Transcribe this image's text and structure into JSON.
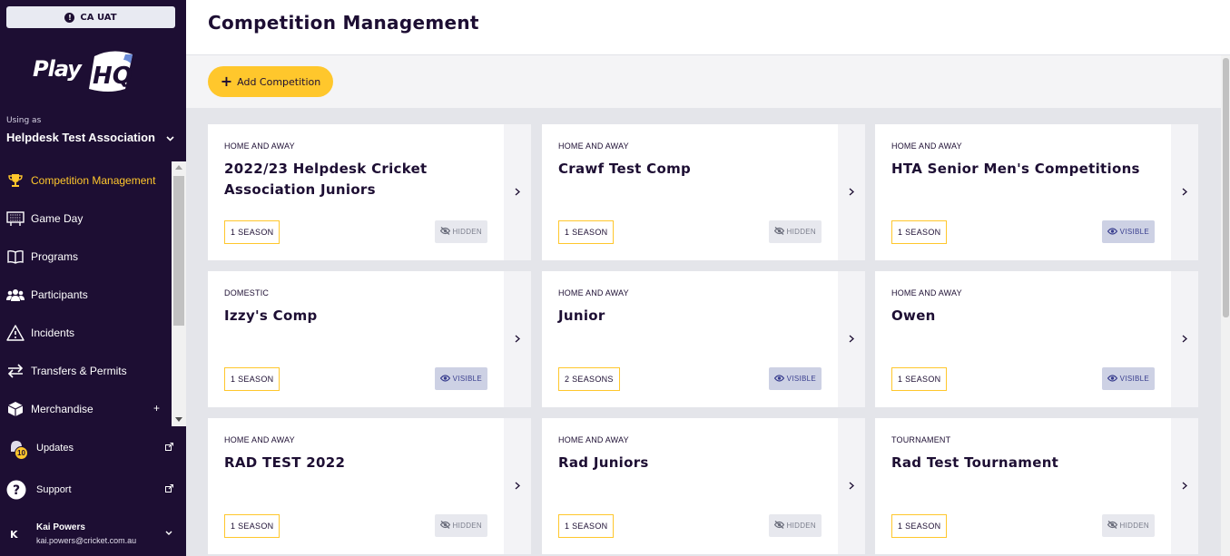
{
  "environment": {
    "label": "CA UAT",
    "icon": "info-icon"
  },
  "brand": {
    "logo_text": "Play",
    "logo_mark": "HQ"
  },
  "org": {
    "using_as": "Using as",
    "name": "Helpdesk Test Association"
  },
  "nav": [
    {
      "label": "Competition Management",
      "icon": "trophy-icon",
      "active": true
    },
    {
      "label": "Game Day",
      "icon": "scoreboard-icon"
    },
    {
      "label": "Programs",
      "icon": "book-icon"
    },
    {
      "label": "Participants",
      "icon": "people-icon"
    },
    {
      "label": "Incidents",
      "icon": "warning-icon"
    },
    {
      "label": "Transfers & Permits",
      "icon": "transfer-icon"
    },
    {
      "label": "Merchandise",
      "icon": "box-icon",
      "expandable": "+"
    }
  ],
  "footer": {
    "updates": {
      "label": "Updates",
      "badge": "10"
    },
    "support": {
      "label": "Support"
    }
  },
  "user": {
    "initial": "K",
    "name": "Kai Powers",
    "email": "kai.powers@cricket.com.au"
  },
  "page": {
    "title": "Competition Management",
    "add_label": "Add Competition"
  },
  "colors": {
    "accent": "#ffc72c",
    "sidebar": "#1d0e33",
    "background": "#e4e5ea"
  },
  "competitions": [
    {
      "type": "HOME AND AWAY",
      "name": "2022/23 Helpdesk Cricket Association Juniors",
      "seasons": "1 SEASON",
      "visibility": "HIDDEN"
    },
    {
      "type": "HOME AND AWAY",
      "name": "Crawf Test Comp",
      "seasons": "1 SEASON",
      "visibility": "HIDDEN"
    },
    {
      "type": "HOME AND AWAY",
      "name": "HTA Senior Men's Competitions",
      "seasons": "1 SEASON",
      "visibility": "VISIBLE"
    },
    {
      "type": "DOMESTIC",
      "name": "Izzy's Comp",
      "seasons": "1 SEASON",
      "visibility": "VISIBLE"
    },
    {
      "type": "HOME AND AWAY",
      "name": "Junior",
      "seasons": "2 SEASONS",
      "visibility": "VISIBLE"
    },
    {
      "type": "HOME AND AWAY",
      "name": "Owen",
      "seasons": "1 SEASON",
      "visibility": "VISIBLE"
    },
    {
      "type": "HOME AND AWAY",
      "name": "RAD TEST 2022",
      "seasons": "1 SEASON",
      "visibility": "HIDDEN"
    },
    {
      "type": "HOME AND AWAY",
      "name": "Rad Juniors",
      "seasons": "1 SEASON",
      "visibility": "HIDDEN"
    },
    {
      "type": "TOURNAMENT",
      "name": "Rad Test Tournament",
      "seasons": "1 SEASON",
      "visibility": "HIDDEN"
    }
  ]
}
